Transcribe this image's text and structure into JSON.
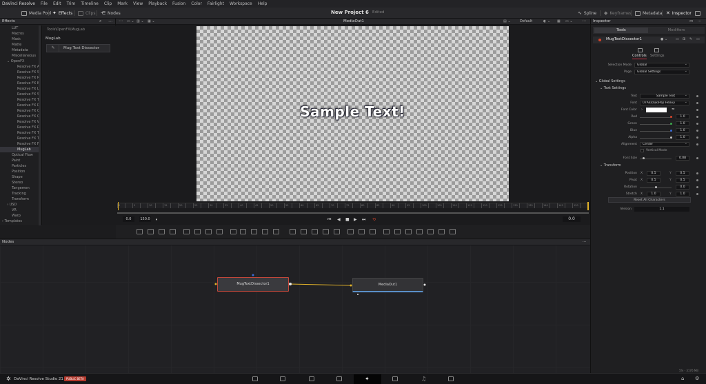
{
  "menubar": {
    "app": "DaVinci Resolve",
    "items": [
      "File",
      "Edit",
      "Trim",
      "Timeline",
      "Clip",
      "Mark",
      "View",
      "Playback",
      "Fusion",
      "Color",
      "Fairlight",
      "Workspace",
      "Help"
    ]
  },
  "toolbar": {
    "media_pool": "Media Pool",
    "effects": "Effects",
    "clips": "Clips",
    "nodes": "Nodes",
    "project_title": "New Project 6",
    "project_status": "Edited",
    "spline": "Spline",
    "keyframes": "Keyframes",
    "metadata": "Metadata",
    "inspector": "Inspector"
  },
  "effects": {
    "title": "Effects",
    "tree": [
      "LUT",
      "Macros",
      "Mask",
      "Matte",
      "Metadata",
      "Miscellaneous",
      "OpenFX",
      "Resolve FX Ae",
      "Resolve FX St",
      "Resolve FX Re",
      "Resolve FX Bl",
      "Resolve FX Lig",
      "Resolve FX St",
      "Resolve FX Te",
      "Resolve FX Re",
      "Resolve FX Co",
      "Resolve FX Ge",
      "Resolve FX Wi",
      "Resolve FX Re",
      "Resolve FX Te",
      "Resolve FX Tr",
      "Resolve FX Fil",
      "MugLab",
      "Optical Flow",
      "Paint",
      "Particles",
      "Position",
      "Shape",
      "Stereo",
      "Tangemen",
      "Tracking",
      "Transform",
      "USD",
      "VR",
      "Warp",
      "Templates"
    ],
    "selected": "MugLab",
    "path": "Tools\\OpenFX\\MugLab",
    "group": "MugLab",
    "item": "Mug Text Dissector"
  },
  "viewer": {
    "title": "MediaOut1",
    "zoom": "Default",
    "sample_text": "Sample Text!",
    "time_start": "0.0",
    "time_end": "150.0",
    "time_current": "0.0",
    "ruler_labels": [
      "0",
      "5",
      "10",
      "15",
      "20",
      "25",
      "30",
      "35",
      "40",
      "45",
      "50",
      "55",
      "60",
      "65",
      "70",
      "75",
      "80",
      "85",
      "90",
      "95",
      "100",
      "105",
      "110",
      "115",
      "120",
      "125",
      "130",
      "135",
      "140",
      "145",
      "150"
    ]
  },
  "inspector": {
    "title": "Inspector",
    "tab_tools": "Tools",
    "tab_modifiers": "Modifiers",
    "node_name": "MugTextDissector1",
    "sub_controls": "Controls",
    "sub_settings": "Settings",
    "selection_mode_label": "Selection Mode",
    "selection_mode_value": "Global",
    "page_label": "Page",
    "page_value": "Global Settings",
    "section_global": "Global Settings",
    "section_text": "Text Settings",
    "text_label": "Text",
    "text_value": "Sample Text",
    "font_label": "Font",
    "font_value": "07AkazukiPop Heavy",
    "font_color_label": "Font Color",
    "red_label": "Red",
    "red_value": "1.0",
    "green_label": "Green",
    "green_value": "1.0",
    "blue_label": "Blue",
    "blue_value": "1.0",
    "alpha_label": "Alpha",
    "alpha_value": "1.0",
    "alignment_label": "Alignment",
    "alignment_value": "Center",
    "vertical_mode_label": "Vertical Mode",
    "font_size_label": "Font Size",
    "font_size_value": "0.08",
    "font_size_level": 0.08,
    "section_transform": "Transform",
    "position_label": "Position",
    "position_x": "0.5",
    "position_y": "0.5",
    "pivot_label": "Pivot",
    "pivot_x": "0.5",
    "pivot_y": "0.5",
    "rotation_label": "Rotation",
    "rotation_value": "0.0",
    "stretch_label": "Stretch",
    "stretch_x": "1.0",
    "stretch_y": "1.0",
    "axis_x": "X",
    "axis_y": "Y",
    "reset_button": "Reset All Characters",
    "version_label": "Version",
    "version_value": "1.1",
    "colors": {
      "red": "#d6442a",
      "green": "#3aa84a",
      "blue": "#3a6ad6"
    }
  },
  "nodes": {
    "title": "Nodes",
    "node_a": "MugTextDissector1",
    "node_b": "MediaOut1"
  },
  "bottombar": {
    "brand": "DaVinci Resolve Studio 21",
    "beta": "PUBLIC BETA",
    "status": "5% - 3176 MB"
  }
}
